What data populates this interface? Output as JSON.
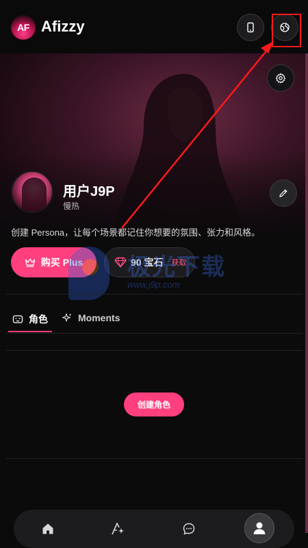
{
  "app": {
    "name": "Afizzy",
    "logo_text": "AF"
  },
  "header": {
    "device_button_icon": "phone-icon",
    "language_button_icon": "globe-icon"
  },
  "profile": {
    "username": "用户J9P",
    "subtitle": "慢热",
    "bio": "创建 Persona，让每个场景都记住你想要的氛围、张力和风格。"
  },
  "actions": {
    "buy_label": "购买 Plus",
    "gems_label": "90 宝石",
    "gems_get_label": "获取"
  },
  "watermark": {
    "text": "极光下载",
    "url": "www.j9p.com"
  },
  "tabs": [
    {
      "label": "角色",
      "active": true
    },
    {
      "label": "Moments",
      "active": false
    }
  ],
  "empty_state": {
    "create_label": "创建角色"
  },
  "nav": {
    "items": [
      {
        "icon": "home-icon"
      },
      {
        "icon": "create-icon"
      },
      {
        "icon": "chat-icon"
      },
      {
        "icon": "profile-icon",
        "active": true
      }
    ]
  },
  "colors": {
    "accent": "#ff3f7e",
    "background": "#0b0b0c",
    "annotation": "#ff1a1a"
  }
}
